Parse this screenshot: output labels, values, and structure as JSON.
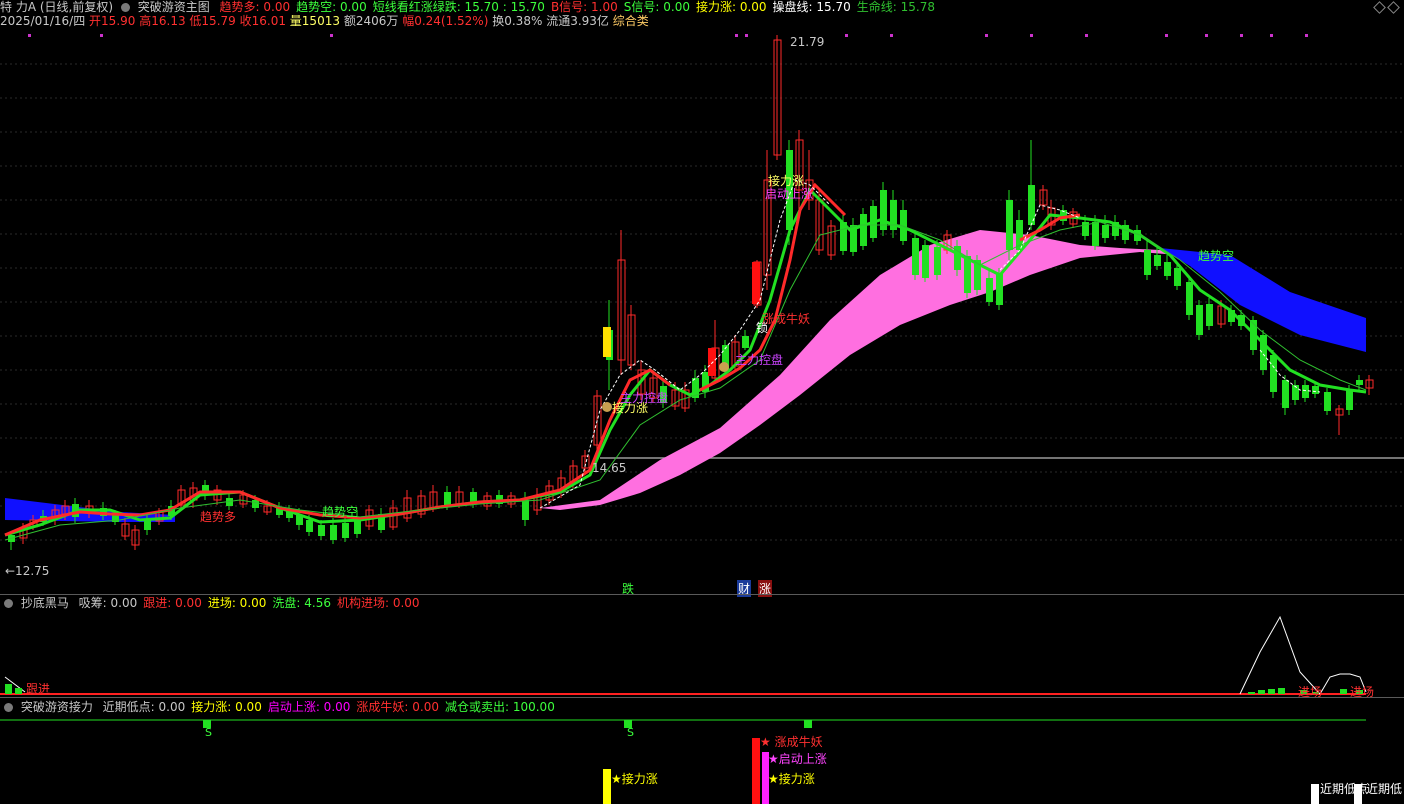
{
  "header": {
    "stock_name": "特 力A",
    "period": "(日线,前复权)",
    "indicator_name": "突破游资主图",
    "items": [
      {
        "text": "趋势多: 0.00",
        "color": "#ff3030"
      },
      {
        "text": "趋势空: 0.00",
        "color": "#3cff3c"
      },
      {
        "text": "短线看红涨绿跌: 15.70 : 15.70",
        "color": "#3cff3c"
      },
      {
        "text": "B信号: 1.00",
        "color": "#ff3030"
      },
      {
        "text": "S信号: 0.00",
        "color": "#3cff3c"
      },
      {
        "text": "接力涨: 0.00",
        "color": "#ffff00"
      },
      {
        "text": "操盘线: 15.70",
        "color": "#ffffff"
      },
      {
        "text": "生命线: 15.78",
        "color": "#30c030"
      }
    ]
  },
  "info": {
    "date": "2025/01/16/四",
    "open": "开15.90",
    "high": "高16.13",
    "low": "低15.79",
    "close": "收16.01",
    "volume": "量15013",
    "amount": "额2406万",
    "change": "幅0.24(1.52%)",
    "turnover": "换0.38%",
    "float": "流通3.93亿",
    "category": "综合类"
  },
  "main_chart": {
    "max_label": "21.79",
    "min_label": "←12.75",
    "ref_label": "14.65",
    "annotations": {
      "trend_short": "趋势空",
      "trend_short_left": "趋势空",
      "jieli_zhang": "接力涨",
      "zhuli_kongpan": "主力控盘",
      "zhuli_kongpan2": "主力控盘",
      "zhang_niuyao": "涨成牛妖",
      "qidong_shangzhang": "启动上涨",
      "jieli_zhang2": "接力涨",
      "suo": "锁",
      "qushi_duo": "趋势多"
    },
    "markers": {
      "die": "跌",
      "cai": "财",
      "zhang": "涨"
    }
  },
  "panel1": {
    "title": "抄底黑马",
    "items": [
      {
        "text": "吸筹: 0.00",
        "color": "#c8c8c8"
      },
      {
        "text": "跟进: 0.00",
        "color": "#ff3030"
      },
      {
        "text": "进场: 0.00",
        "color": "#ffff00"
      },
      {
        "text": "洗盘: 4.56",
        "color": "#3cff3c"
      },
      {
        "text": "机构进场: 0.00",
        "color": "#ff3030"
      }
    ],
    "labels": {
      "genjin": "跟进",
      "jinchang1": "进场",
      "jinchang2": "进场"
    }
  },
  "panel2": {
    "title": "突破游资接力",
    "items": [
      {
        "text": "近期低点: 0.00",
        "color": "#c8c8c8"
      },
      {
        "text": "接力涨: 0.00",
        "color": "#ffff00"
      },
      {
        "text": "启动上涨: 0.00",
        "color": "#ff00ff"
      },
      {
        "text": "涨成牛妖: 0.00",
        "color": "#ff3030"
      },
      {
        "text": "减仓或卖出: 100.00",
        "color": "#3cff3c"
      }
    ],
    "labels": {
      "s1": "S",
      "s2": "S",
      "jieli1": "★接力涨",
      "zhangniu": "★ 涨成牛妖",
      "qidong": "★启动上涨",
      "jieli2": "★接力涨",
      "jinqi1": "近期低点",
      "jinqi2": "近期低"
    }
  },
  "colors": {
    "up": "#ff2a2a",
    "down": "#22e022",
    "ribbon": "#ff6fe0",
    "blue": "#1010ff",
    "grid": "#2a2a2a"
  }
}
